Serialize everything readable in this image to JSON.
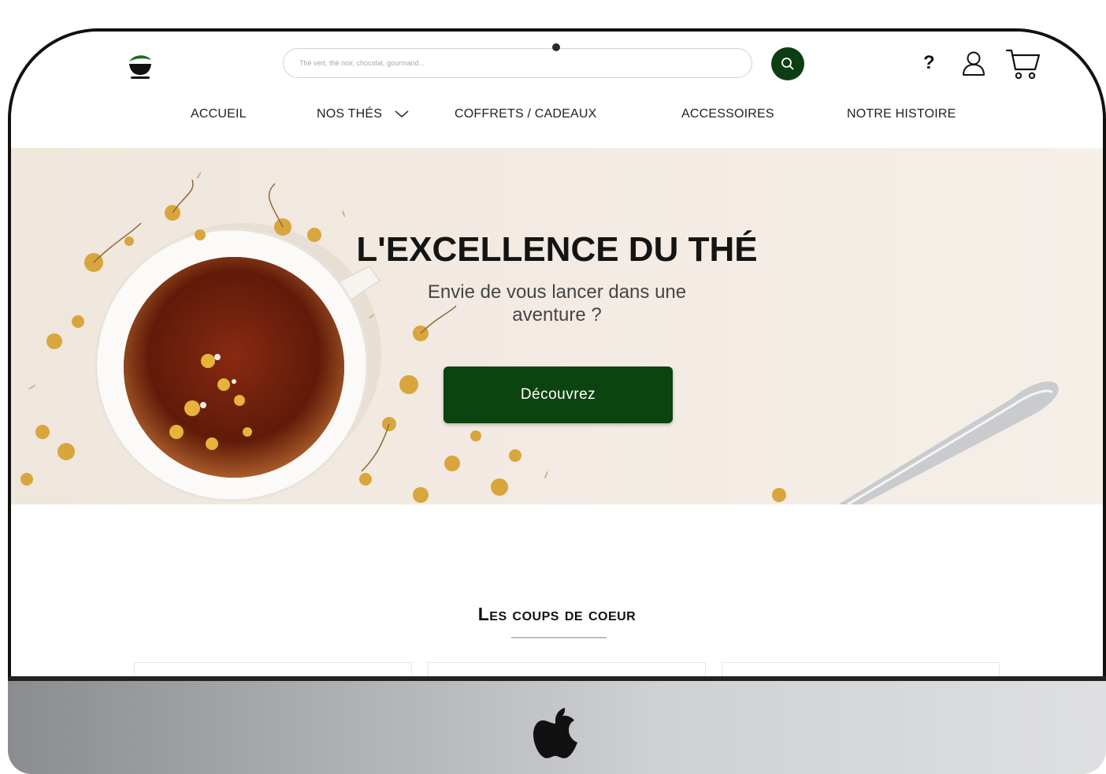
{
  "header": {
    "search_placeholder": "Thé vert, thé noir, chocolat, gourmand...",
    "help_label": "?"
  },
  "nav": {
    "items": [
      {
        "label": "ACCUEIL"
      },
      {
        "label": "NOS THÉS"
      },
      {
        "label": "COFFRETS / CADEAUX"
      },
      {
        "label": "ACCESSOIRES"
      },
      {
        "label": "NOTRE HISTOIRE"
      }
    ]
  },
  "hero": {
    "title": "L'EXCELLENCE DU THÉ",
    "subtitle": "Envie de vous lancer dans une aventure ?",
    "cta_label": "Découvrez"
  },
  "section": {
    "title": "Les coups de coeur"
  },
  "icons": {
    "logo": "teacup-leaf-icon",
    "search": "search-icon",
    "user": "user-icon",
    "cart": "cart-icon",
    "dropdown": "chevron-down-icon",
    "device_logo": "apple-logo-icon"
  },
  "colors": {
    "brand_green": "#0b4410",
    "hero_background": "#f2eae2",
    "text": "#141414"
  }
}
